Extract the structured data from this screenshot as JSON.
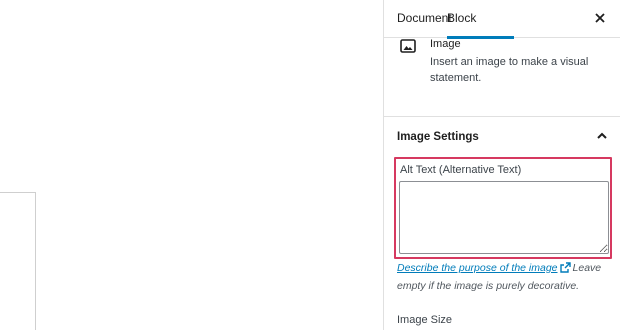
{
  "tabs": {
    "document": "Document",
    "block": "Block"
  },
  "block_card": {
    "title": "Image",
    "description": "Insert an image to make a visual statement.",
    "icon": "image-icon"
  },
  "panel": {
    "title": "Image Settings",
    "alt_label": "Alt Text (Alternative Text)",
    "alt_value": "",
    "help_link": "Describe the purpose of the image",
    "help_rest": "Leave empty if the image is purely decorative.",
    "image_size_label": "Image Size"
  },
  "colors": {
    "accent": "#007cba",
    "highlight": "#d63960"
  }
}
